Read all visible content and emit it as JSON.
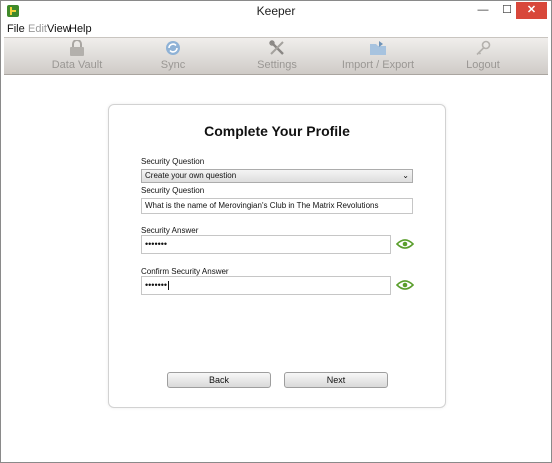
{
  "window": {
    "title": "Keeper"
  },
  "menu": [
    {
      "label": "File",
      "disabled": false
    },
    {
      "label": "Edit",
      "disabled": true
    },
    {
      "label": "View",
      "disabled": false
    },
    {
      "label": "Help",
      "disabled": false
    }
  ],
  "toolbar": {
    "data_vault": "Data Vault",
    "sync": "Sync",
    "settings": "Settings",
    "import_export": "Import / Export",
    "logout": "Logout"
  },
  "form": {
    "heading": "Complete Your Profile",
    "question_select_label": "Security Question",
    "question_select_value": "Create your own question",
    "question_text_label": "Security Question",
    "question_text_value": "What is the name of Merovingian's Club in The Matrix Revolutions",
    "answer_label": "Security Answer",
    "answer_value": "•••••••",
    "confirm_label": "Confirm Security Answer",
    "confirm_value": "•••••••"
  },
  "buttons": {
    "back": "Back",
    "next": "Next"
  },
  "colors": {
    "accent_green": "#5a9e2c",
    "close_red": "#d8473a"
  }
}
